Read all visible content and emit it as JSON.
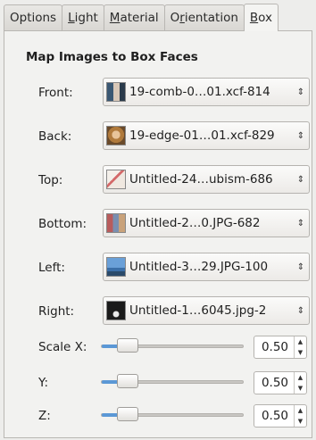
{
  "tabs": [
    {
      "pre": "",
      "u": "",
      "post": "Options"
    },
    {
      "pre": "",
      "u": "L",
      "post": "ight"
    },
    {
      "pre": "",
      "u": "M",
      "post": "aterial"
    },
    {
      "pre": "O",
      "u": "r",
      "post": "ientation"
    },
    {
      "pre": "",
      "u": "B",
      "post": "ox"
    }
  ],
  "active_tab": "Box",
  "section_title": "Map Images to Box Faces",
  "faces": [
    {
      "label": "Front:",
      "value": "19-comb-0…01.xcf-814",
      "thumb_icon": "portrait-thumbnail-icon"
    },
    {
      "label": "Back:",
      "value": "19-edge-01…01.xcf-829",
      "thumb_icon": "face-thumbnail-icon"
    },
    {
      "label": "Top:",
      "value": "Untitled-24…ubism-686",
      "thumb_icon": "drawing-thumbnail-icon"
    },
    {
      "label": "Bottom:",
      "value": "Untitled-2…0.JPG-682",
      "thumb_icon": "photo-thumbnail-icon"
    },
    {
      "label": "Left:",
      "value": "Untitled-3…29.JPG-100",
      "thumb_icon": "landscape-thumbnail-icon"
    },
    {
      "label": "Right:",
      "value": "Untitled-1…6045.jpg-2",
      "thumb_icon": "night-thumbnail-icon"
    }
  ],
  "scale": [
    {
      "label": "Scale X:",
      "value": "0.50",
      "level": 0.5
    },
    {
      "label": "Y:",
      "value": "0.50",
      "level": 0.5
    },
    {
      "label": "Z:",
      "value": "0.50",
      "level": 0.5
    }
  ],
  "colors": {
    "accent": "#5b98d6"
  }
}
